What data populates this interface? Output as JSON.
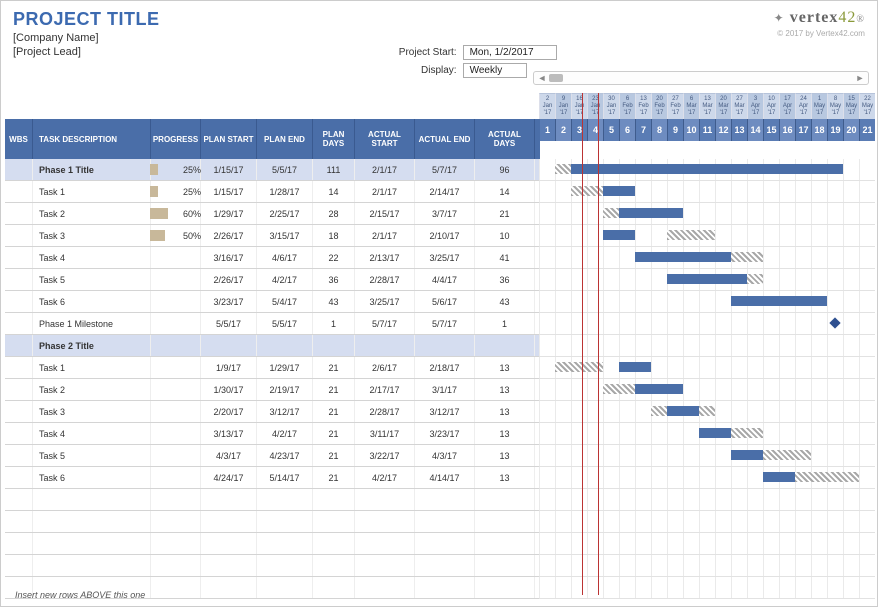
{
  "header": {
    "title": "PROJECT TITLE",
    "company": "[Company Name]",
    "lead": "[Project Lead]",
    "project_start_label": "Project Start:",
    "project_start_value": "Mon, 1/2/2017",
    "display_label": "Display:",
    "display_value": "Weekly",
    "logo_text": "vertex42",
    "copyright": "© 2017 by Vertex42.com"
  },
  "columns": {
    "wbs": "WBS",
    "desc": "TASK DESCRIPTION",
    "prog": "PROGRESS",
    "pstart": "PLAN START",
    "pend": "PLAN END",
    "pdays": "PLAN DAYS",
    "astart": "ACTUAL START",
    "aend": "ACTUAL END",
    "adays": "ACTUAL DAYS"
  },
  "timeline": {
    "dates": [
      "2 Jan '17",
      "9 Jan '17",
      "16 Jan '17",
      "23 Jan '17",
      "30 Jan '17",
      "6 Feb '17",
      "13 Feb '17",
      "20 Feb '17",
      "27 Feb '17",
      "6 Mar '17",
      "13 Mar '17",
      "20 Mar '17",
      "27 Mar '17",
      "3 Apr '17",
      "10 Apr '17",
      "17 Apr '17",
      "24 Apr '17",
      "1 May '17",
      "8 May '17",
      "15 May '17",
      "22 May '17"
    ],
    "numbers": [
      1,
      2,
      3,
      4,
      5,
      6,
      7,
      8,
      9,
      10,
      11,
      12,
      13,
      14,
      15,
      16,
      17,
      18,
      19,
      20,
      21
    ],
    "today_col": 3
  },
  "rows": [
    {
      "type": "phase",
      "desc": "Phase 1 Title",
      "progress": "25%",
      "pstart": "1/15/17",
      "pend": "5/5/17",
      "pdays": "111",
      "astart": "2/1/17",
      "aend": "5/7/17",
      "adays": "96",
      "plan": [
        2,
        19
      ],
      "actual": [
        1,
        4
      ]
    },
    {
      "type": "task",
      "desc": "Task 1",
      "progress": "25%",
      "pstart": "1/15/17",
      "pend": "1/28/17",
      "pdays": "14",
      "astart": "2/1/17",
      "aend": "2/14/17",
      "adays": "14",
      "plan": [
        4,
        6
      ],
      "actual": [
        2,
        4
      ]
    },
    {
      "type": "task",
      "desc": "Task 2",
      "progress": "60%",
      "pstart": "1/29/17",
      "pend": "2/25/17",
      "pdays": "28",
      "astart": "2/15/17",
      "aend": "3/7/17",
      "adays": "21",
      "plan": [
        5,
        9
      ],
      "actual": [
        4,
        8
      ]
    },
    {
      "type": "task",
      "desc": "Task 3",
      "progress": "50%",
      "pstart": "2/26/17",
      "pend": "3/15/17",
      "pdays": "18",
      "astart": "2/1/17",
      "aend": "2/10/17",
      "adays": "10",
      "plan": [
        4,
        6
      ],
      "actual": [
        8,
        11
      ]
    },
    {
      "type": "task",
      "desc": "Task 4",
      "progress": "",
      "pstart": "3/16/17",
      "pend": "4/6/17",
      "pdays": "22",
      "astart": "2/13/17",
      "aend": "3/25/17",
      "adays": "41",
      "plan": [
        6,
        12
      ],
      "actual": [
        10,
        14
      ]
    },
    {
      "type": "task",
      "desc": "Task 5",
      "progress": "",
      "pstart": "2/26/17",
      "pend": "4/2/17",
      "pdays": "36",
      "astart": "2/28/17",
      "aend": "4/4/17",
      "adays": "36",
      "plan": [
        8,
        13
      ],
      "actual": [
        8,
        14
      ]
    },
    {
      "type": "task",
      "desc": "Task 6",
      "progress": "",
      "pstart": "3/23/17",
      "pend": "5/4/17",
      "pdays": "43",
      "astart": "3/25/17",
      "aend": "5/6/17",
      "adays": "43",
      "plan": [
        12,
        18
      ],
      "actual": [
        12,
        18
      ]
    },
    {
      "type": "task",
      "desc": "Phase 1 Milestone",
      "progress": "",
      "pstart": "5/5/17",
      "pend": "5/5/17",
      "pdays": "1",
      "astart": "5/7/17",
      "aend": "5/7/17",
      "adays": "1",
      "milestone": 18
    },
    {
      "type": "phase",
      "desc": "Phase 2 Title",
      "progress": "",
      "pstart": "",
      "pend": "",
      "pdays": "",
      "astart": "",
      "aend": "",
      "adays": ""
    },
    {
      "type": "task",
      "desc": "Task 1",
      "progress": "",
      "pstart": "1/9/17",
      "pend": "1/29/17",
      "pdays": "21",
      "astart": "2/6/17",
      "aend": "2/18/17",
      "adays": "13",
      "plan": [
        5,
        7
      ],
      "actual": [
        1,
        4
      ]
    },
    {
      "type": "task",
      "desc": "Task 2",
      "progress": "",
      "pstart": "1/30/17",
      "pend": "2/19/17",
      "pdays": "21",
      "astart": "2/17/17",
      "aend": "3/1/17",
      "adays": "13",
      "plan": [
        6,
        9
      ],
      "actual": [
        4,
        7
      ]
    },
    {
      "type": "task",
      "desc": "Task 3",
      "progress": "",
      "pstart": "2/20/17",
      "pend": "3/12/17",
      "pdays": "21",
      "astart": "2/28/17",
      "aend": "3/12/17",
      "adays": "13",
      "plan": [
        8,
        10
      ],
      "actual": [
        7,
        11
      ]
    },
    {
      "type": "task",
      "desc": "Task 4",
      "progress": "",
      "pstart": "3/13/17",
      "pend": "4/2/17",
      "pdays": "21",
      "astart": "3/11/17",
      "aend": "3/23/17",
      "adays": "13",
      "plan": [
        10,
        12
      ],
      "actual": [
        10,
        14
      ]
    },
    {
      "type": "task",
      "desc": "Task 5",
      "progress": "",
      "pstart": "4/3/17",
      "pend": "4/23/17",
      "pdays": "21",
      "astart": "3/22/17",
      "aend": "4/3/17",
      "adays": "13",
      "plan": [
        12,
        14
      ],
      "actual": [
        13,
        17
      ]
    },
    {
      "type": "task",
      "desc": "Task 6",
      "progress": "",
      "pstart": "4/24/17",
      "pend": "5/14/17",
      "pdays": "21",
      "astart": "4/2/17",
      "aend": "4/14/17",
      "adays": "13",
      "plan": [
        14,
        16
      ],
      "actual": [
        16,
        20
      ]
    }
  ],
  "footer_note": "Insert new rows ABOVE this one"
}
